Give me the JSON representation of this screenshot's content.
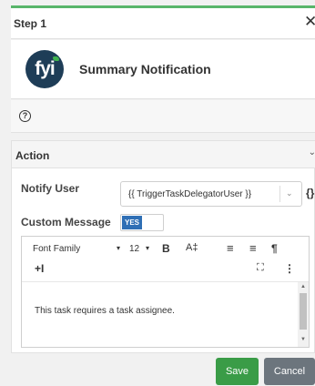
{
  "step": {
    "title": "Step 1",
    "close_glyph": "✕"
  },
  "summary": {
    "logo_text": "fyi",
    "title": "Summary Notification"
  },
  "help": {
    "icon_glyph": "?"
  },
  "action": {
    "title": "Action",
    "chevron_glyph": "⌄",
    "notify_user": {
      "label": "Notify User",
      "value": "{{ TriggerTaskDelegatorUser }}",
      "chevron_glyph": "⌄",
      "brace_glyph": "{}"
    },
    "custom_message": {
      "label": "Custom Message",
      "toggle_on_label": "YES"
    }
  },
  "editor": {
    "toolbar": {
      "font_family": "Font Family",
      "font_family_caret": "▾",
      "font_size": "12",
      "font_size_caret": "▾",
      "bold": "B",
      "text_size": "A‡",
      "align_left": "≡",
      "align_center": "≡",
      "paragraph": "¶",
      "insert": "+I",
      "fullscreen": "⛶",
      "more": "⋮"
    },
    "content": "This task requires a task assignee."
  },
  "buttons": {
    "save": "Save",
    "cancel": "Cancel"
  },
  "colors": {
    "accent_green": "#58b56a",
    "save_green": "#3a9c47",
    "toggle_blue": "#2f6fb5",
    "cancel_gray": "#6c757d",
    "logo_navy": "#1e3d57"
  }
}
